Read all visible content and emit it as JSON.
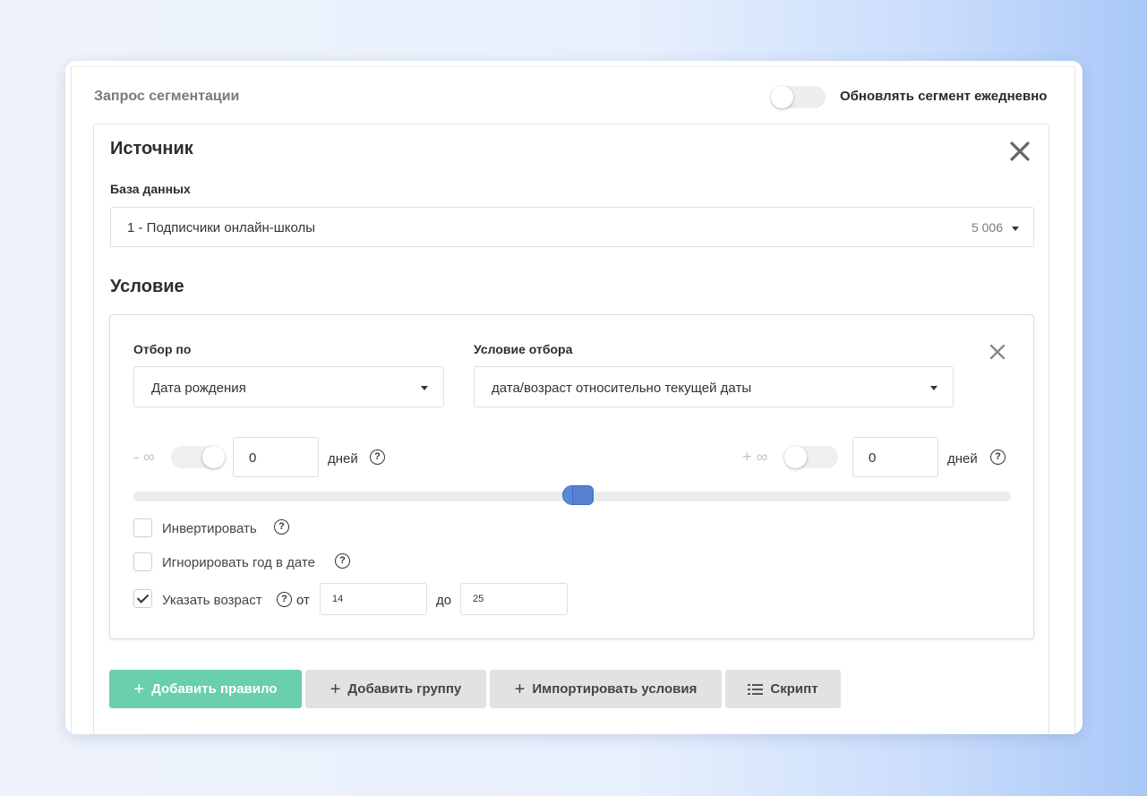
{
  "header": {
    "title": "Запрос сегментации",
    "daily_update_label": "Обновлять сегмент ежедневно",
    "daily_update_on": false
  },
  "source": {
    "heading": "Источник",
    "db_label": "База данных",
    "db_value": "1 - Подписчики онлайн-школы",
    "db_count": "5 006"
  },
  "condition": {
    "heading": "Условие",
    "filter_by_label": "Отбор по",
    "filter_by_value": "Дата рождения",
    "filter_cond_label": "Условие отбора",
    "filter_cond_value": "дата/возраст относительно текущей даты",
    "min_infinity": "- ∞",
    "min_infinity_on": false,
    "min_value": "0",
    "min_unit": "дней",
    "max_infinity": "+ ∞",
    "max_infinity_on": false,
    "max_value": "0",
    "max_unit": "дней",
    "slider_position": 0.5,
    "invert_label": "Инвертировать",
    "invert_checked": false,
    "ignore_year_label": "Игнорировать год в дате",
    "ignore_year_checked": false,
    "age_label": "Указать возраст",
    "age_checked": true,
    "age_from_label": "от",
    "age_from": "14",
    "age_to_label": "до",
    "age_to": "25",
    "help_glyph": "?"
  },
  "buttons": {
    "add_rule": "Добавить правило",
    "add_group": "Добавить группу",
    "import": "Импортировать условия",
    "script": "Скрипт",
    "plus_glyph": "+"
  },
  "colors": {
    "accent_green": "#6acfab",
    "slider_blue": "#5b88d8",
    "secondary_button": "#e2e2e2"
  }
}
